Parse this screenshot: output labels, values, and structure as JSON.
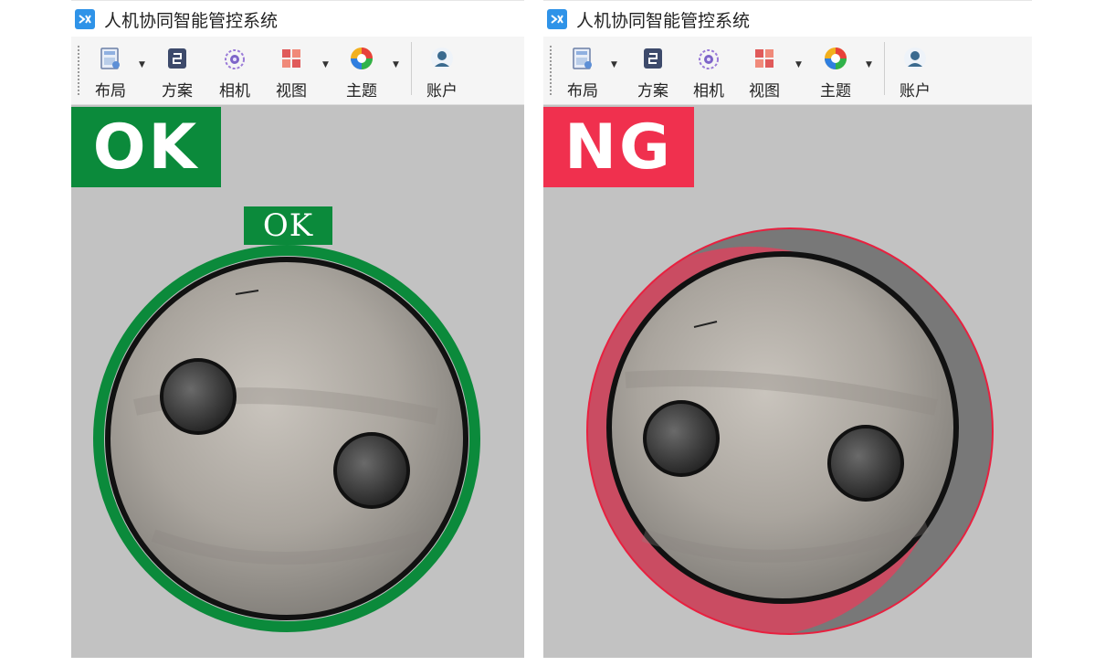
{
  "window_title": "人机协同智能管控系统",
  "toolbar": {
    "layout": "布局",
    "scheme": "方案",
    "camera": "相机",
    "view": "视图",
    "theme": "主题",
    "account": "账户"
  },
  "left_panel": {
    "status_badge": "OK",
    "part_label": "OK"
  },
  "right_panel": {
    "status_badge": "NG"
  },
  "colors": {
    "ok_green": "#0b8a3b",
    "ng_red": "#f0304e",
    "background_gray": "#c2c2c2",
    "app_blue": "#2f93e8"
  },
  "icons": [
    "app-logo-icon",
    "layout-icon",
    "scheme-icon",
    "camera-icon",
    "view-icon",
    "theme-icon",
    "account-icon"
  ]
}
